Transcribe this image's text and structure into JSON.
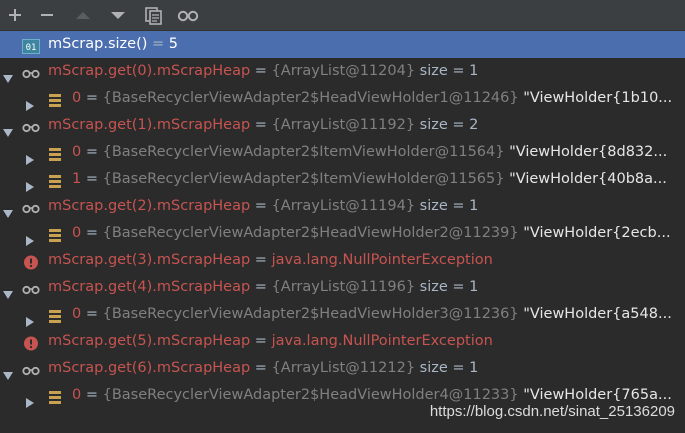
{
  "toolbar": {
    "buttons": [
      "add-icon",
      "remove-icon",
      "move-up-icon",
      "move-down-icon",
      "copy-icon",
      "watch-glasses-icon"
    ]
  },
  "rows": {
    "r0": {
      "name": "mScrap.size()",
      "eq": " = ",
      "val": "5"
    },
    "r1": {
      "name": "mScrap.get(0).mScrapHeap",
      "eq": " = ",
      "ref": "{ArrayList@11204}",
      "size": " size = 1"
    },
    "r2": {
      "name": "0",
      "eq": " = ",
      "ref": "{BaseRecyclerViewAdapter2$HeadViewHolder1@11246}",
      "str": " \"ViewHolder{1b10..."
    },
    "r3": {
      "name": "mScrap.get(1).mScrapHeap",
      "eq": " = ",
      "ref": "{ArrayList@11192}",
      "size": " size = 2"
    },
    "r4": {
      "name": "0",
      "eq": " = ",
      "ref": "{BaseRecyclerViewAdapter2$ItemViewHolder@11564}",
      "str": " \"ViewHolder{8d832..."
    },
    "r5": {
      "name": "1",
      "eq": " = ",
      "ref": "{BaseRecyclerViewAdapter2$ItemViewHolder@11565}",
      "str": " \"ViewHolder{40b8a..."
    },
    "r6": {
      "name": "mScrap.get(2).mScrapHeap",
      "eq": " = ",
      "ref": "{ArrayList@11194}",
      "size": " size = 1"
    },
    "r7": {
      "name": "0",
      "eq": " = ",
      "ref": "{BaseRecyclerViewAdapter2$HeadViewHolder2@11239}",
      "str": " \"ViewHolder{2ecb..."
    },
    "r8": {
      "name": "mScrap.get(3).mScrapHeap",
      "eq": " = ",
      "err": "java.lang.NullPointerException"
    },
    "r9": {
      "name": "mScrap.get(4).mScrapHeap",
      "eq": " = ",
      "ref": "{ArrayList@11196}",
      "size": " size = 1"
    },
    "r10": {
      "name": "0",
      "eq": " = ",
      "ref": "{BaseRecyclerViewAdapter2$HeadViewHolder3@11236}",
      "str": " \"ViewHolder{a548..."
    },
    "r11": {
      "name": "mScrap.get(5).mScrapHeap",
      "eq": " = ",
      "err": "java.lang.NullPointerException"
    },
    "r12": {
      "name": "mScrap.get(6).mScrapHeap",
      "eq": " = ",
      "ref": "{ArrayList@11212}",
      "size": " size = 1"
    },
    "r13": {
      "name": "0",
      "eq": " = ",
      "ref": "{BaseRecyclerViewAdapter2$HeadViewHolder4@11233}",
      "str": " \"ViewHolder{765a..."
    }
  },
  "watermark": "https://blog.csdn.net/sinat_25136209",
  "colors": {
    "background": "#2b2b2b",
    "toolbar": "#3c3f41",
    "selection": "#4b6eaf",
    "name": "#c75450",
    "reference": "#808080",
    "error": "#c75450"
  }
}
